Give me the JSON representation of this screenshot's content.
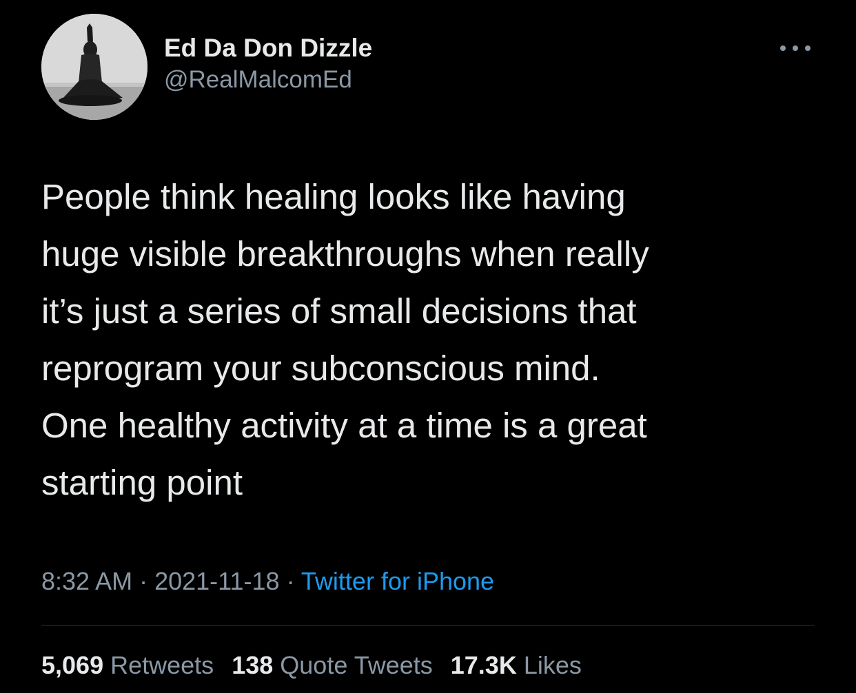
{
  "author": {
    "display_name": "Ed Da Don Dizzle",
    "handle": "@RealMalcomEd",
    "avatar_icon": "profile-photo"
  },
  "more_icon": "ellipsis-icon",
  "tweet": {
    "text": "People think healing looks like having\nhuge visible breakthroughs when really\nit’s just a series of small decisions that\nreprogram your subconscious mind.\nOne healthy activity at a time is a great\nstarting point"
  },
  "meta": {
    "time": "8:32 AM",
    "separator": " · ",
    "date": "2021-11-18",
    "source": "Twitter for iPhone"
  },
  "stats": {
    "retweets": {
      "count": "5,069",
      "label": "Retweets"
    },
    "quotes": {
      "count": "138",
      "label": "Quote Tweets"
    },
    "likes": {
      "count": "17.3K",
      "label": "Likes"
    }
  },
  "colors": {
    "background": "#000000",
    "text_primary": "#e7e9ea",
    "text_secondary": "#8b98a5",
    "link": "#1d9bf0",
    "divider": "#2f3336"
  }
}
